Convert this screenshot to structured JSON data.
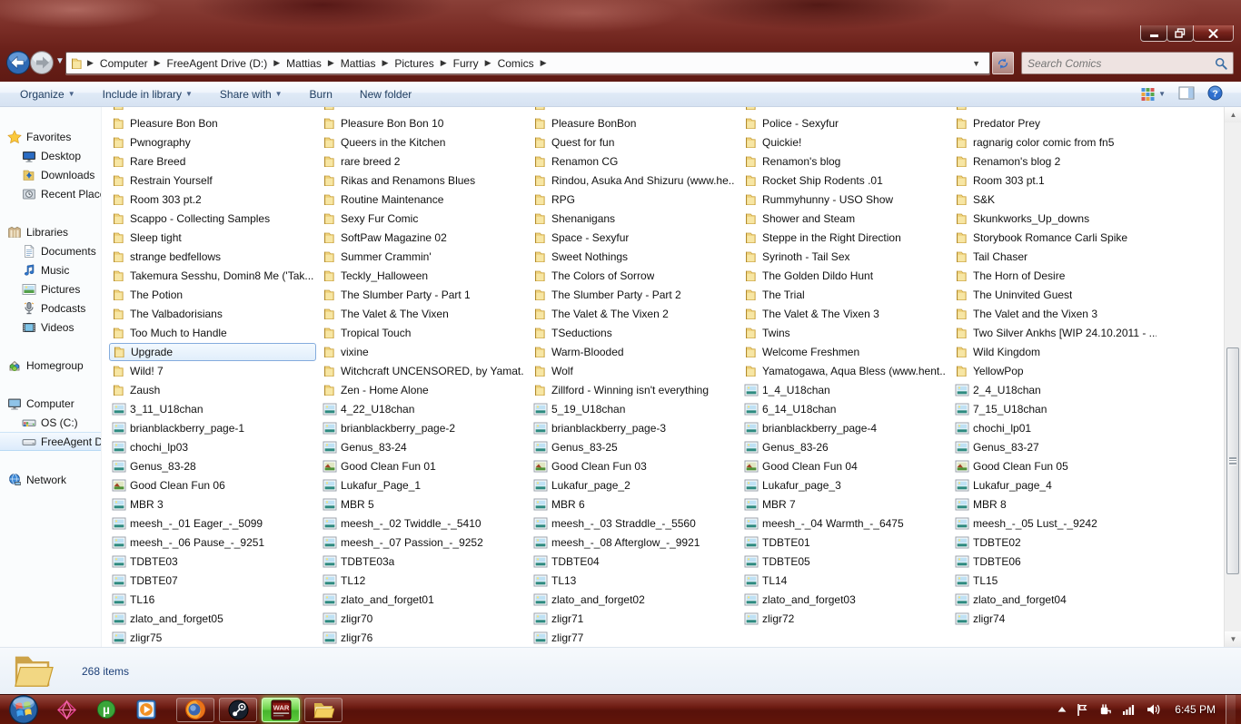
{
  "window": {
    "controls": [
      "minimize",
      "restore",
      "close"
    ],
    "breadcrumb": [
      "Computer",
      "FreeAgent Drive (D:)",
      "Mattias",
      "Mattias",
      "Pictures",
      "Furry",
      "Comics"
    ],
    "search_placeholder": "Search Comics"
  },
  "command_bar": {
    "buttons": [
      {
        "label": "Organize",
        "dropdown": true
      },
      {
        "label": "Include in library",
        "dropdown": true
      },
      {
        "label": "Share with",
        "dropdown": true
      },
      {
        "label": "Burn",
        "dropdown": false
      },
      {
        "label": "New folder",
        "dropdown": false
      }
    ],
    "right_icons": [
      "views",
      "preview-pane",
      "help"
    ]
  },
  "sidebar": {
    "groups": [
      {
        "label": "Favorites",
        "icon": "star",
        "children": [
          {
            "label": "Desktop",
            "icon": "desktop"
          },
          {
            "label": "Downloads",
            "icon": "downloads"
          },
          {
            "label": "Recent Places",
            "icon": "recent"
          }
        ]
      },
      {
        "label": "Libraries",
        "icon": "libraries",
        "children": [
          {
            "label": "Documents",
            "icon": "documents"
          },
          {
            "label": "Music",
            "icon": "music"
          },
          {
            "label": "Pictures",
            "icon": "pictures"
          },
          {
            "label": "Podcasts",
            "icon": "podcasts"
          },
          {
            "label": "Videos",
            "icon": "videos"
          }
        ]
      },
      {
        "label": "Homegroup",
        "icon": "homegroup",
        "children": []
      },
      {
        "label": "Computer",
        "icon": "computer",
        "children": [
          {
            "label": "OS (C:)",
            "icon": "os-drive"
          },
          {
            "label": "FreeAgent Drive (D:)",
            "icon": "ext-drive",
            "selected": true
          }
        ]
      },
      {
        "label": "Network",
        "icon": "network",
        "children": []
      }
    ]
  },
  "files": {
    "clipped_top_row": true,
    "columns": [
      {
        "items": [
          {
            "name": "Pleasure Bon Bon",
            "type": "folder"
          },
          {
            "name": "Pwnography",
            "type": "folder"
          },
          {
            "name": "Rare Breed",
            "type": "folder"
          },
          {
            "name": "Restrain Yourself",
            "type": "folder"
          },
          {
            "name": "Room 303 pt.2",
            "type": "folder"
          },
          {
            "name": "Scappo - Collecting Samples",
            "type": "folder"
          },
          {
            "name": "Sleep tight",
            "type": "folder"
          },
          {
            "name": "strange bedfellows",
            "type": "folder"
          },
          {
            "name": "Takemura Sesshu, Domin8 Me ('Tak...",
            "type": "folder"
          },
          {
            "name": "The Potion",
            "type": "folder"
          },
          {
            "name": "The Valbadorisians",
            "type": "folder"
          },
          {
            "name": "Too Much to Handle",
            "type": "folder"
          },
          {
            "name": "Upgrade",
            "type": "folder",
            "selected": true
          },
          {
            "name": "Wild! 7",
            "type": "folder"
          },
          {
            "name": "Zaush",
            "type": "folder"
          },
          {
            "name": "3_11_U18chan",
            "type": "image"
          },
          {
            "name": "brianblackberry_page-1",
            "type": "image"
          },
          {
            "name": "chochi_lp03",
            "type": "image"
          },
          {
            "name": "Genus_83-28",
            "type": "image"
          },
          {
            "name": "Good Clean Fun 06",
            "type": "image-alt"
          },
          {
            "name": "MBR 3",
            "type": "image"
          },
          {
            "name": "meesh_-_01 Eager_-_5099",
            "type": "image"
          },
          {
            "name": "meesh_-_06 Pause_-_9251",
            "type": "image"
          },
          {
            "name": "TDBTE03",
            "type": "image"
          },
          {
            "name": "TDBTE07",
            "type": "image"
          },
          {
            "name": "TL16",
            "type": "image"
          },
          {
            "name": "zlato_and_forget05",
            "type": "image"
          },
          {
            "name": "zligr75",
            "type": "image"
          }
        ]
      },
      {
        "items": [
          {
            "name": "Pleasure Bon Bon 10",
            "type": "folder"
          },
          {
            "name": "Queers in the Kitchen",
            "type": "folder"
          },
          {
            "name": "rare breed 2",
            "type": "folder"
          },
          {
            "name": "Rikas and Renamons Blues",
            "type": "folder"
          },
          {
            "name": "Routine Maintenance",
            "type": "folder"
          },
          {
            "name": "Sexy Fur Comic",
            "type": "folder"
          },
          {
            "name": "SoftPaw Magazine 02",
            "type": "folder"
          },
          {
            "name": "Summer Crammin'",
            "type": "folder"
          },
          {
            "name": "Teckly_Halloween",
            "type": "folder"
          },
          {
            "name": "The Slumber Party - Part 1",
            "type": "folder"
          },
          {
            "name": "The Valet & The Vixen",
            "type": "folder"
          },
          {
            "name": "Tropical Touch",
            "type": "folder"
          },
          {
            "name": "vixine",
            "type": "folder"
          },
          {
            "name": "Witchcraft UNCENSORED, by Yamat...",
            "type": "folder"
          },
          {
            "name": "Zen - Home Alone",
            "type": "folder"
          },
          {
            "name": "4_22_U18chan",
            "type": "image"
          },
          {
            "name": "brianblackberry_page-2",
            "type": "image"
          },
          {
            "name": "Genus_83-24",
            "type": "image"
          },
          {
            "name": "Good Clean Fun 01",
            "type": "image-alt"
          },
          {
            "name": "Lukafur_Page_1",
            "type": "image"
          },
          {
            "name": "MBR 5",
            "type": "image"
          },
          {
            "name": "meesh_-_02 Twiddle_-_5410",
            "type": "image"
          },
          {
            "name": "meesh_-_07 Passion_-_9252",
            "type": "image"
          },
          {
            "name": "TDBTE03a",
            "type": "image"
          },
          {
            "name": "TL12",
            "type": "image"
          },
          {
            "name": "zlato_and_forget01",
            "type": "image"
          },
          {
            "name": "zligr70",
            "type": "image"
          },
          {
            "name": "zligr76",
            "type": "image"
          }
        ]
      },
      {
        "items": [
          {
            "name": "Pleasure BonBon",
            "type": "folder"
          },
          {
            "name": "Quest for fun",
            "type": "folder"
          },
          {
            "name": "Renamon CG",
            "type": "folder"
          },
          {
            "name": "Rindou, Asuka And Shizuru (www.he...",
            "type": "folder"
          },
          {
            "name": "RPG",
            "type": "folder"
          },
          {
            "name": "Shenanigans",
            "type": "folder"
          },
          {
            "name": "Space - Sexyfur",
            "type": "folder"
          },
          {
            "name": "Sweet Nothings",
            "type": "folder"
          },
          {
            "name": "The Colors of Sorrow",
            "type": "folder"
          },
          {
            "name": "The Slumber Party - Part 2",
            "type": "folder"
          },
          {
            "name": "The Valet & The Vixen 2",
            "type": "folder"
          },
          {
            "name": "TSeductions",
            "type": "folder"
          },
          {
            "name": "Warm-Blooded",
            "type": "folder"
          },
          {
            "name": "Wolf",
            "type": "folder"
          },
          {
            "name": "Zillford - Winning isn't everything",
            "type": "folder"
          },
          {
            "name": "5_19_U18chan",
            "type": "image"
          },
          {
            "name": "brianblackberry_page-3",
            "type": "image"
          },
          {
            "name": "Genus_83-25",
            "type": "image"
          },
          {
            "name": "Good Clean Fun 03",
            "type": "image-alt"
          },
          {
            "name": "Lukafur_page_2",
            "type": "image"
          },
          {
            "name": "MBR 6",
            "type": "image"
          },
          {
            "name": "meesh_-_03 Straddle_-_5560",
            "type": "image"
          },
          {
            "name": "meesh_-_08 Afterglow_-_9921",
            "type": "image"
          },
          {
            "name": "TDBTE04",
            "type": "image"
          },
          {
            "name": "TL13",
            "type": "image"
          },
          {
            "name": "zlato_and_forget02",
            "type": "image"
          },
          {
            "name": "zligr71",
            "type": "image"
          },
          {
            "name": "zligr77",
            "type": "image"
          }
        ]
      },
      {
        "items": [
          {
            "name": "Police - Sexyfur",
            "type": "folder"
          },
          {
            "name": "Quickie!",
            "type": "folder"
          },
          {
            "name": "Renamon's blog",
            "type": "folder"
          },
          {
            "name": "Rocket Ship Rodents .01",
            "type": "folder"
          },
          {
            "name": "Rummyhunny - USO Show",
            "type": "folder"
          },
          {
            "name": "Shower and Steam",
            "type": "folder"
          },
          {
            "name": "Steppe in the Right Direction",
            "type": "folder"
          },
          {
            "name": "Syrinoth - Tail Sex",
            "type": "folder"
          },
          {
            "name": "The Golden Dildo Hunt",
            "type": "folder"
          },
          {
            "name": "The Trial",
            "type": "folder"
          },
          {
            "name": "The Valet & The Vixen 3",
            "type": "folder"
          },
          {
            "name": "Twins",
            "type": "folder"
          },
          {
            "name": "Welcome Freshmen",
            "type": "folder"
          },
          {
            "name": "Yamatogawa, Aqua Bless (www.hent...",
            "type": "folder"
          },
          {
            "name": "1_4_U18chan",
            "type": "image"
          },
          {
            "name": "6_14_U18chan",
            "type": "image"
          },
          {
            "name": "brianblackberry_page-4",
            "type": "image"
          },
          {
            "name": "Genus_83-26",
            "type": "image"
          },
          {
            "name": "Good Clean Fun 04",
            "type": "image-alt"
          },
          {
            "name": "Lukafur_page_3",
            "type": "image"
          },
          {
            "name": "MBR 7",
            "type": "image"
          },
          {
            "name": "meesh_-_04 Warmth_-_6475",
            "type": "image"
          },
          {
            "name": "TDBTE01",
            "type": "image"
          },
          {
            "name": "TDBTE05",
            "type": "image"
          },
          {
            "name": "TL14",
            "type": "image"
          },
          {
            "name": "zlato_and_forget03",
            "type": "image"
          },
          {
            "name": "zligr72",
            "type": "image"
          }
        ]
      },
      {
        "items": [
          {
            "name": "Predator Prey",
            "type": "folder"
          },
          {
            "name": "ragnarig color comic from fn5",
            "type": "folder"
          },
          {
            "name": "Renamon's blog 2",
            "type": "folder"
          },
          {
            "name": "Room 303 pt.1",
            "type": "folder"
          },
          {
            "name": "S&K",
            "type": "folder"
          },
          {
            "name": "Skunkworks_Up_downs",
            "type": "folder"
          },
          {
            "name": "Storybook Romance Carli Spike",
            "type": "folder"
          },
          {
            "name": "Tail Chaser",
            "type": "folder"
          },
          {
            "name": "The Horn of Desire",
            "type": "folder"
          },
          {
            "name": "The Uninvited Guest",
            "type": "folder"
          },
          {
            "name": "The Valet and the Vixen 3",
            "type": "folder"
          },
          {
            "name": "Two Silver Ankhs [WIP 24.10.2011 - ...",
            "type": "folder"
          },
          {
            "name": "Wild Kingdom",
            "type": "folder"
          },
          {
            "name": "YellowPop",
            "type": "folder"
          },
          {
            "name": "2_4_U18chan",
            "type": "image"
          },
          {
            "name": "7_15_U18chan",
            "type": "image"
          },
          {
            "name": "chochi_lp01",
            "type": "image"
          },
          {
            "name": "Genus_83-27",
            "type": "image"
          },
          {
            "name": "Good Clean Fun 05",
            "type": "image-alt"
          },
          {
            "name": "Lukafur_page_4",
            "type": "image"
          },
          {
            "name": "MBR 8",
            "type": "image"
          },
          {
            "name": "meesh_-_05 Lust_-_9242",
            "type": "image"
          },
          {
            "name": "TDBTE02",
            "type": "image"
          },
          {
            "name": "TDBTE06",
            "type": "image"
          },
          {
            "name": "TL15",
            "type": "image"
          },
          {
            "name": "zlato_and_forget04",
            "type": "image"
          },
          {
            "name": "zligr74",
            "type": "image"
          }
        ]
      }
    ]
  },
  "status_bar": {
    "count": "268 items"
  },
  "taskbar": {
    "quick_icons": [
      "pink-app",
      "utorrent",
      "media-player"
    ],
    "app_buttons": [
      {
        "icon": "firefox",
        "highlight": false
      },
      {
        "icon": "steam",
        "highlight": false
      },
      {
        "icon": "war-game",
        "highlight": true
      },
      {
        "icon": "explorer",
        "highlight": false
      }
    ],
    "tray_icons": [
      "show-hidden",
      "action-center",
      "power",
      "network-signal",
      "volume"
    ],
    "time": "6:45 PM"
  },
  "colors": {
    "glass_red": "#6f241c",
    "selection_border": "#84acdd",
    "selection_fill": "#e3effc",
    "status_text": "#1c3f77"
  }
}
